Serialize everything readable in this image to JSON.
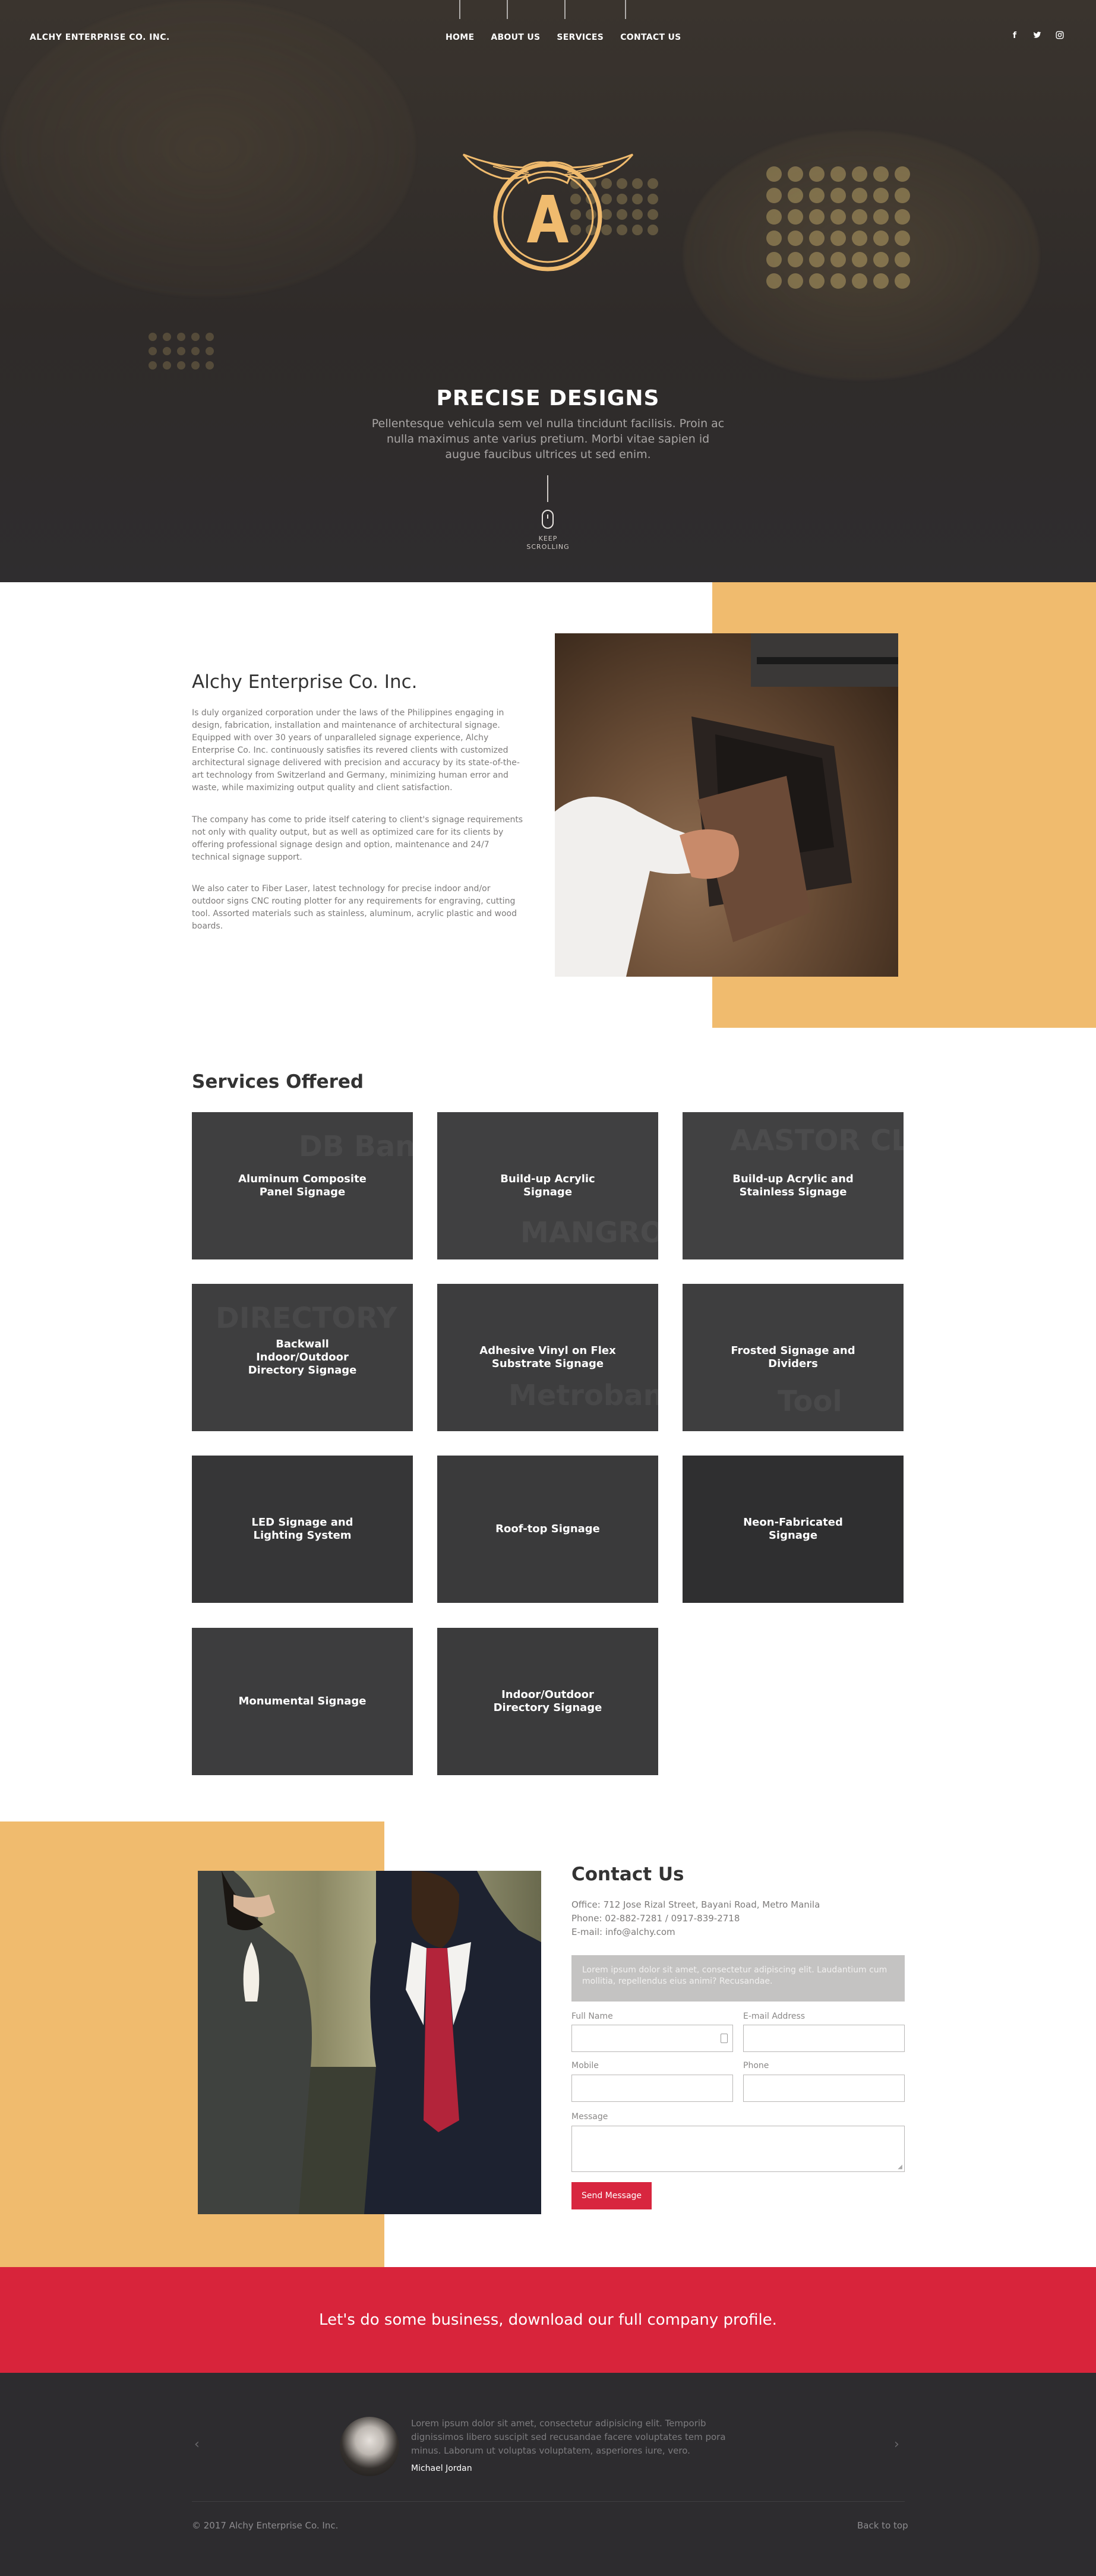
{
  "header": {
    "brand": "ALCHY ENTERPRISE CO. INC.",
    "nav": [
      "HOME",
      "ABOUT US",
      "SERVICES",
      "CONTACT US"
    ],
    "social_icons": [
      "facebook-icon",
      "twitter-icon",
      "instagram-icon"
    ]
  },
  "hero": {
    "title": "PRECISE DESIGNS",
    "subtitle": "Pellentesque vehicula sem vel nulla tincidunt facilisis. Proin ac nulla maximus ante varius pretium. Morbi vitae sapien id augue faucibus ultrices ut sed enim.",
    "logo_letter": "A",
    "scroll_line1": "KEEP",
    "scroll_line2": "SCROLLING"
  },
  "about": {
    "title": "Alchy Enterprise Co. Inc.",
    "p1": "Is duly organized corporation under the laws of the Philippines engaging in design, fabrication, installation and maintenance of architectural signage. Equipped with over 30 years of unparalleled signage experience, Alchy Enterprise Co. Inc. continuously satisfies its revered clients with customized architectural signage delivered with precision and accuracy by its state-of-the-art technology from Switzerland and Germany, minimizing human error and waste, while maximizing output quality and client satisfaction.",
    "p2": "The company has come to pride itself catering to client's signage requirements not only with quality output, but as well as optimized care for its clients by offering professional signage design and option, maintenance and 24/7 technical signage support.",
    "p3": "We also cater to Fiber Laser, latest technology for precise indoor and/or outdoor signs CNC routing plotter for any requirements for engraving, cutting tool. Assorted materials such as stainless, aluminum, acrylic plastic and wood boards."
  },
  "services": {
    "title": "Services Offered",
    "items": [
      {
        "label": "Aluminum Composite Panel Signage",
        "bg": "#3f3f40",
        "watermark": "DB  Bank"
      },
      {
        "label": "Build-up Acrylic Signage",
        "bg": "#404041",
        "watermark": "MANGROVE"
      },
      {
        "label": "Build-up Acrylic and Stainless Signage",
        "bg": "#414142",
        "watermark": "AASTOR CLUB"
      },
      {
        "label": "Backwall Indoor/Outdoor Directory Signage",
        "bg": "#3e3e3f",
        "watermark": "DIRECTORY"
      },
      {
        "label": "Adhesive Vinyl on Flex Substrate Signage",
        "bg": "#3d3d3e",
        "watermark": "Metrobank"
      },
      {
        "label": "Frosted Signage and Dividers",
        "bg": "#3e3e3f",
        "watermark": "Tool"
      },
      {
        "label": "LED Signage and Lighting System",
        "bg": "#363637",
        "watermark": ""
      },
      {
        "label": "Roof-top Signage",
        "bg": "#3a3a3b",
        "watermark": ""
      },
      {
        "label": "Neon-Fabricated Signage",
        "bg": "#2f2f30",
        "watermark": ""
      },
      {
        "label": "Monumental Signage",
        "bg": "#3d3d3e",
        "watermark": ""
      },
      {
        "label": "Indoor/Outdoor Directory Signage",
        "bg": "#3b3b3c",
        "watermark": ""
      }
    ]
  },
  "contact": {
    "title": "Contact Us",
    "office": "Office: 712 Jose Rizal Street, Bayani Road, Metro Manila",
    "phone": "Phone: 02-882-7281 / 0917-839-2718",
    "email": "E-mail: info@alchy.com",
    "notice": "Lorem ipsum dolor sit amet, consectetur adipiscing elit. Laudantium cum mollitia, repellendus eius animi? Recusandae.",
    "full_name_label": "Full Name",
    "email_label": "E-mail Address",
    "mobile_label": "Mobile",
    "phone_label": "Phone",
    "message_label": "Message",
    "send_label": "Send Message"
  },
  "cta": {
    "text": "Let's do some business, download our full company profile."
  },
  "testimonial": {
    "quote": "Lorem ipsum dolor sit amet, consectetur adipisicing elit. Temporib dignissimos libero suscipit sed recusandae facere voluptates tem pora minus. Laborum ut voluptas voluptatem, asperiores iure, vero.",
    "name": "Michael Jordan",
    "prev": "‹",
    "next": "›"
  },
  "footer": {
    "copyright": "© 2017 Alchy Enterprise Co. Inc.",
    "back_to_top": "Back to top"
  },
  "colors": {
    "accent_yellow": "#f0bb6e",
    "accent_red": "#d8243b",
    "hero_dark": "#2f2d2f",
    "footer_dark": "#2d2c2f"
  }
}
